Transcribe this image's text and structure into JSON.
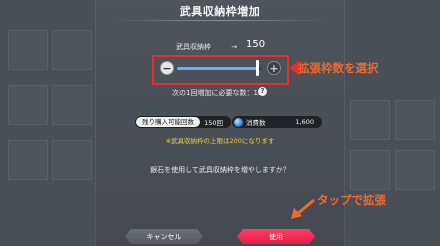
{
  "dialog": {
    "title": "武具収納枠増加",
    "capacity_label": "武具収納枠",
    "capacity_arrow": "→",
    "capacity_value": "150",
    "slider": {
      "minus_symbol": "−",
      "plus_symbol": "+",
      "fill_fraction": 0.95
    },
    "next_cost_text": "次の1回増加に必要な数：15",
    "help_symbol": "?",
    "remaining_purchases_label": "残り購入可能回数",
    "remaining_purchases_value": "150回",
    "consumed_label": "消費数",
    "consumed_value": "1,600",
    "limit_notice": "※武具収納枠の上限は200になります",
    "confirm_question": "銀石を使用して武具収納枠を増やしますか？",
    "cancel_label": "キャンセル",
    "use_label": "使用"
  },
  "annotations": {
    "select_text": "拡張枠数を選択",
    "tap_text": "タップで拡張",
    "color": "#f16a2c",
    "highlight_color": "#e8302c"
  }
}
